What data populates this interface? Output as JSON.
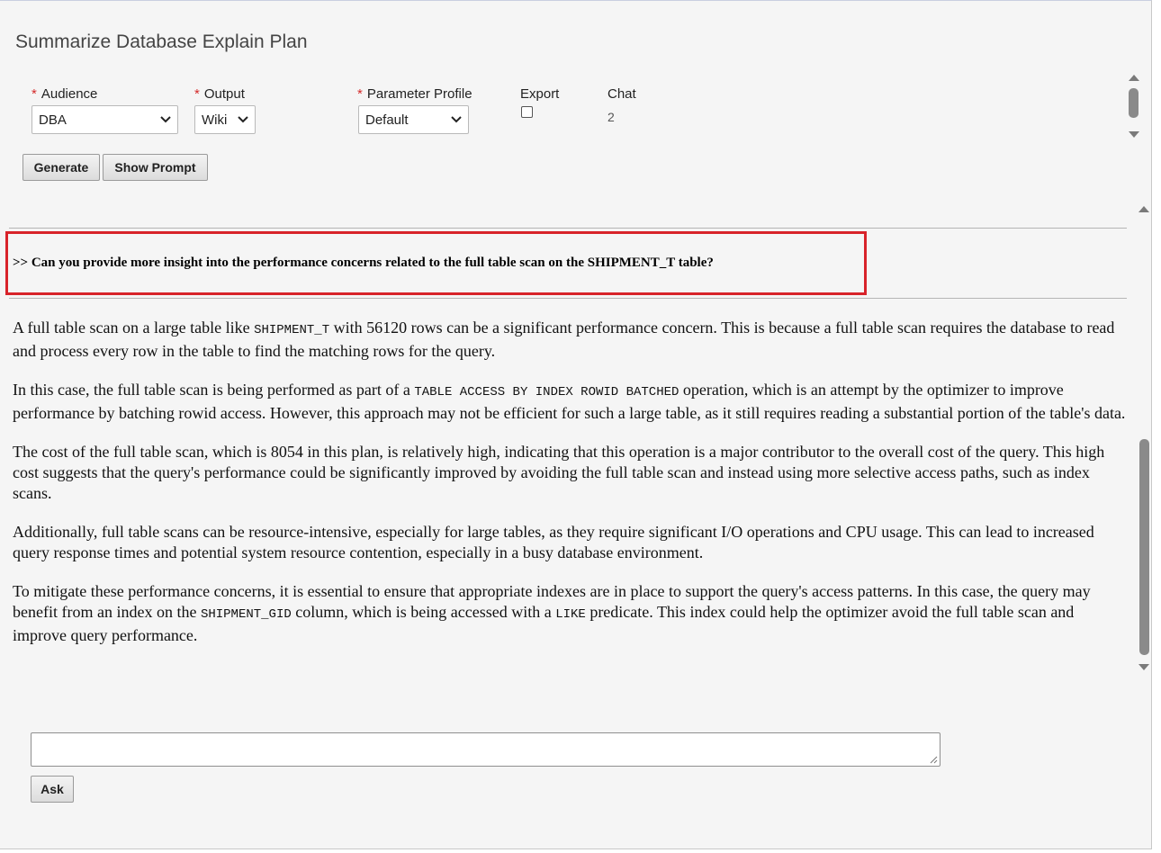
{
  "page": {
    "title": "Summarize Database Explain Plan"
  },
  "form": {
    "audience": {
      "label": "Audience",
      "value": "DBA"
    },
    "output": {
      "label": "Output",
      "value": "Wiki"
    },
    "parameter_profile": {
      "label": "Parameter Profile",
      "value": "Default"
    },
    "export": {
      "label": "Export",
      "checked": false
    },
    "chat": {
      "label": "Chat",
      "value": "2"
    },
    "required_marker": "*"
  },
  "buttons": {
    "generate": "Generate",
    "show_prompt": "Show Prompt",
    "ask": "Ask"
  },
  "question": ">> Can you provide more insight into the performance concerns related to the full table scan on the SHIPMENT_T table?",
  "answer": {
    "p1": {
      "a": "A full table scan on a large table like ",
      "code1": "SHIPMENT_T",
      "b": " with 56120 rows can be a significant performance concern. This is because a full table scan requires the database to read and process every row in the table to find the matching rows for the query."
    },
    "p2": {
      "a": "In this case, the full table scan is being performed as part of a ",
      "code1": "TABLE ACCESS BY INDEX ROWID BATCHED",
      "b": " operation, which is an attempt by the optimizer to improve performance by batching rowid access. However, this approach may not be efficient for such a large table, as it still requires reading a substantial portion of the table's data."
    },
    "p3": "The cost of the full table scan, which is 8054 in this plan, is relatively high, indicating that this operation is a major contributor to the overall cost of the query. This high cost suggests that the query's performance could be significantly improved by avoiding the full table scan and instead using more selective access paths, such as index scans.",
    "p4": "Additionally, full table scans can be resource-intensive, especially for large tables, as they require significant I/O operations and CPU usage. This can lead to increased query response times and potential system resource contention, especially in a busy database environment.",
    "p5": {
      "a": "To mitigate these performance concerns, it is essential to ensure that appropriate indexes are in place to support the query's access patterns. In this case, the query may benefit from an index on the ",
      "code1": "SHIPMENT_GID",
      "b": " column, which is being accessed with a ",
      "code2": "LIKE",
      "c": " predicate. This index could help the optimizer avoid the full table scan and improve query performance."
    }
  },
  "ask_input": {
    "value": ""
  },
  "colors": {
    "highlight_border": "#d8232a",
    "required": "#d42a2a"
  }
}
